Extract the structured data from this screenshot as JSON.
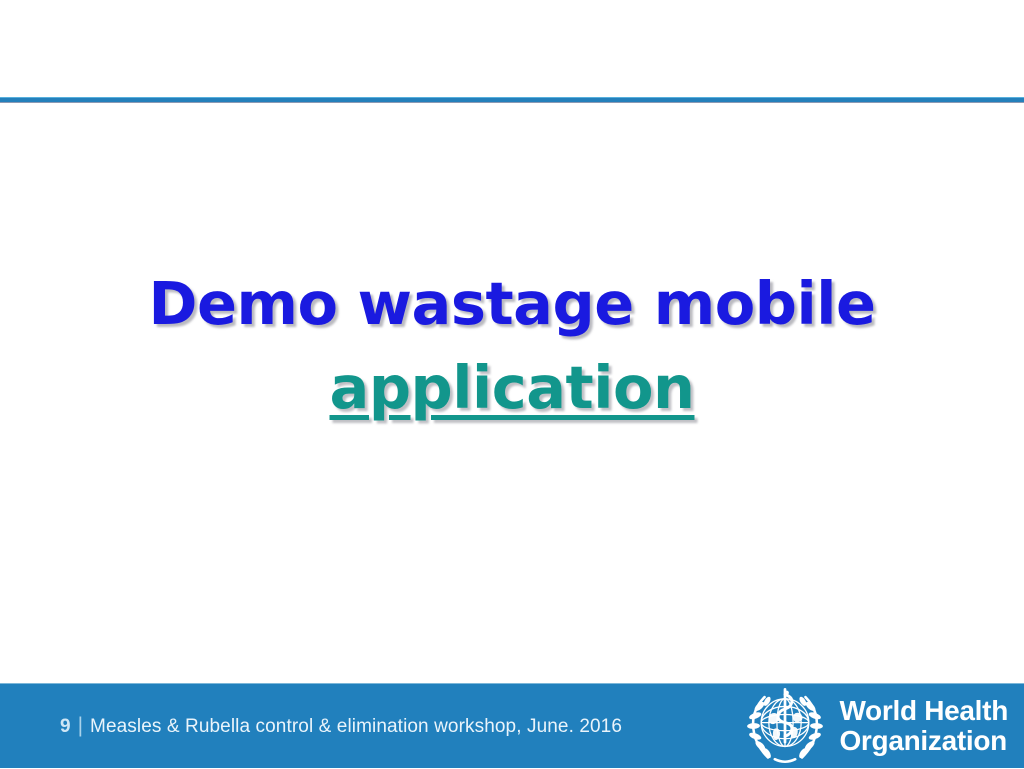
{
  "slide": {
    "background_color": "#ffffff",
    "accent_color": "#2180bd",
    "title_color": "#1a1ae0",
    "subtitle_color": "#12968c"
  },
  "header": {
    "title_placeholder": "",
    "ghost_text": "",
    "rule_color": "#2480bb"
  },
  "content": {
    "headline_line_1": "Demo wastage mobile",
    "headline_line_2": "application"
  },
  "footer": {
    "page_number": "9",
    "separator": "|",
    "text": "Measles & Rubella control & elimination workshop, June. 2016",
    "bar_color": "#2180bd"
  },
  "logo": {
    "emblem_name": "who-emblem",
    "line_1": "World Health",
    "line_2": "Organization"
  }
}
